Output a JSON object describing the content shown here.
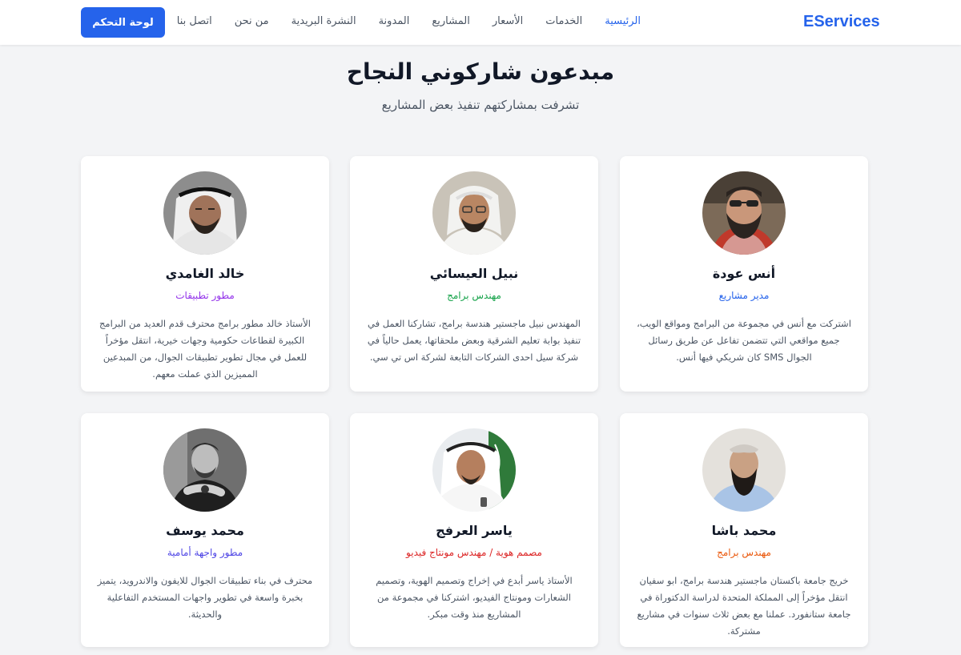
{
  "header": {
    "brand": "EServices",
    "nav": [
      {
        "label": "الرئيسية",
        "active": true
      },
      {
        "label": "الخدمات",
        "active": false
      },
      {
        "label": "الأسعار",
        "active": false
      },
      {
        "label": "المشاريع",
        "active": false
      },
      {
        "label": "المدونة",
        "active": false
      },
      {
        "label": "النشرة البريدية",
        "active": false
      },
      {
        "label": "من نحن",
        "active": false
      },
      {
        "label": "اتصل بنا",
        "active": false
      }
    ],
    "dashboard_button": "لوحة التحكم"
  },
  "section": {
    "title": "مبدعون شاركوني النجاح",
    "subtitle": "تشرفت بمشاركتهم تنفيذ بعض المشاريع"
  },
  "people": [
    {
      "name": "أنس عودة",
      "role": "مدير مشاريع",
      "role_color": "#2563eb",
      "bio": "اشتركت مع أنس في مجموعة من البرامج ومواقع الويب، جميع مواقعي التي تتضمن تفاعل عن طريق رسائل الجوال SMS كان شريكي فيها أنس."
    },
    {
      "name": "نبيل العيسائي",
      "role": "مهندس برامج",
      "role_color": "#16a34a",
      "bio": "المهندس نبيل ماجستير هندسة برامج، تشاركنا العمل في تنفيذ بوابة تعليم الشرقية وبعض ملحقاتها، يعمل حالياً في شركة سيل احدى الشركات التابعة لشركة اس تي سي."
    },
    {
      "name": "خالد الغامدي",
      "role": "مطور تطبيقات",
      "role_color": "#9333ea",
      "bio": "الأستاذ خالد مطور برامج محترف قدم العديد من البرامج الكبيرة لقطاعات حكومية وجهات خيرية، انتقل مؤخراً للعمل في مجال تطوير تطبيقات الجوال، من المبدعين المميزين الذي عملت معهم."
    },
    {
      "name": "محمد باشا",
      "role": "مهندس برامج",
      "role_color": "#ea580c",
      "bio": "خريج جامعة باكستان ماجستير هندسة برامج، ابو سفيان انتقل مؤخراً إلى المملكة المتحدة لدراسة الدكتوراة في جامعة ستانفورد. عملنا مع بعض ثلاث سنوات في مشاريع مشتركة."
    },
    {
      "name": "ياسر العرفج",
      "role": "مصمم هوية / مهندس مونتاج فيديو",
      "role_color": "#dc2626",
      "bio": "الأستاذ ياسر أبدع في إخراج وتصميم الهوية، وتصميم الشعارات ومونتاج الفيديو، اشتركنا في مجموعة من المشاريع منذ وقت مبكر."
    },
    {
      "name": "محمد يوسف",
      "role": "مطور واجهة أمامية",
      "role_color": "#4f46e5",
      "bio": "محترف في بناء تطبيقات الجوال للايفون والاندرويد، يتميز بخبرة واسعة في تطوير واجهات المستخدم التفاعلية والحديثة."
    }
  ]
}
